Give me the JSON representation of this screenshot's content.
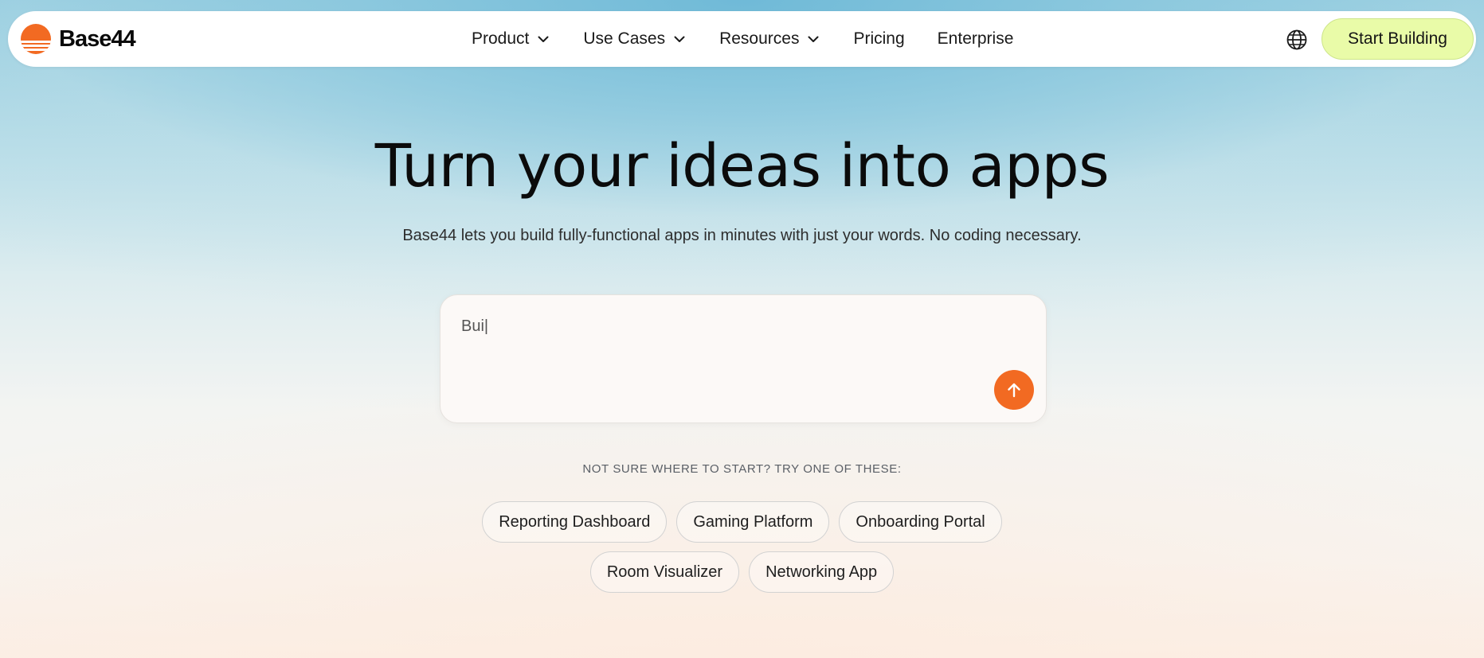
{
  "brand": {
    "name": "Base44",
    "accent": "#f26a22",
    "cta_bg": "#e9fba8"
  },
  "nav": {
    "items": [
      {
        "label": "Product",
        "has_dropdown": true,
        "icon": "chevron-down-icon"
      },
      {
        "label": "Use Cases",
        "has_dropdown": true,
        "icon": "chevron-down-icon"
      },
      {
        "label": "Resources",
        "has_dropdown": true,
        "icon": "chevron-down-icon"
      },
      {
        "label": "Pricing",
        "has_dropdown": false
      },
      {
        "label": "Enterprise",
        "has_dropdown": false
      }
    ],
    "language_icon": "globe-icon",
    "cta_label": "Start Building"
  },
  "hero": {
    "title": "Turn your ideas into apps",
    "subtitle": "Base44 lets you build fully-functional apps in minutes with just your words. No coding necessary."
  },
  "prompt": {
    "value": "Bui|",
    "submit_icon": "arrow-up-icon"
  },
  "suggestions": {
    "label": "NOT SURE WHERE TO START? TRY ONE OF THESE:",
    "chips": [
      "Reporting Dashboard",
      "Gaming Platform",
      "Onboarding Portal",
      "Room Visualizer",
      "Networking App"
    ]
  }
}
